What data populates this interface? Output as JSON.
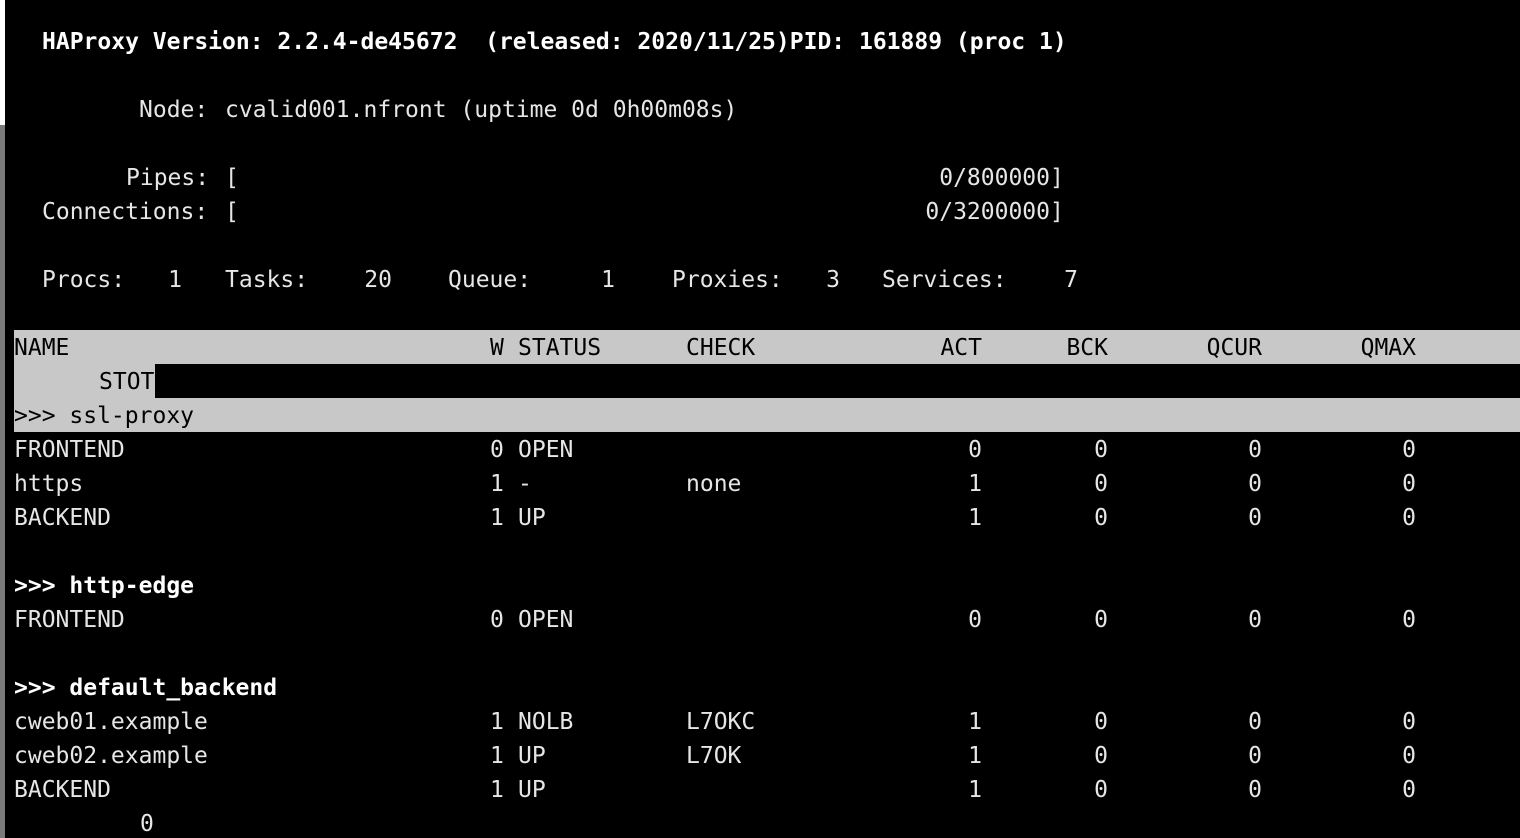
{
  "header": {
    "version_line": "HAProxy Version: 2.2.4-de45672  (released: 2020/11/25)PID: 161889 (proc 1)",
    "node_label": "Node:",
    "node_value": "cvalid001.nfront (uptime 0d 0h00m08s)",
    "pipes_label": "Pipes:",
    "pipes_value": "0/800000",
    "connections_label": "Connections:",
    "connections_value": "0/3200000",
    "bracket_open": "[",
    "bracket_close": "]"
  },
  "stats": {
    "procs_label": "Procs:",
    "procs_value": "1",
    "tasks_label": "Tasks:",
    "tasks_value": "20",
    "queue_label": "Queue:",
    "queue_value": "1",
    "proxies_label": "Proxies:",
    "proxies_value": "3",
    "services_label": "Services:",
    "services_value": "7"
  },
  "columns": {
    "name": "NAME",
    "w": "W",
    "status": "STATUS",
    "check": "CHECK",
    "act": "ACT",
    "bck": "BCK",
    "qcur": "QCUR",
    "qmax": "QMAX",
    "stot": "STOT"
  },
  "groups": [
    {
      "title": ">>> ssl-proxy",
      "rows": [
        {
          "name": "FRONTEND",
          "w": "0",
          "status": "OPEN",
          "check": "",
          "act": "0",
          "bck": "0",
          "qcur": "0",
          "qmax": "0"
        },
        {
          "name": "https",
          "w": "1",
          "status": "-",
          "check": "none",
          "act": "1",
          "bck": "0",
          "qcur": "0",
          "qmax": "0"
        },
        {
          "name": "BACKEND",
          "w": "1",
          "status": "UP",
          "check": "",
          "act": "1",
          "bck": "0",
          "qcur": "0",
          "qmax": "0"
        }
      ]
    },
    {
      "title": ">>> http-edge",
      "rows": [
        {
          "name": "FRONTEND",
          "w": "0",
          "status": "OPEN",
          "check": "",
          "act": "0",
          "bck": "0",
          "qcur": "0",
          "qmax": "0"
        }
      ]
    },
    {
      "title": ">>> default_backend",
      "rows": [
        {
          "name": "cweb01.example",
          "w": "1",
          "status": "NOLB",
          "check": "L7OKC",
          "act": "1",
          "bck": "0",
          "qcur": "0",
          "qmax": "0"
        },
        {
          "name": "cweb02.example",
          "w": "1",
          "status": "UP",
          "check": "L7OK",
          "act": "1",
          "bck": "0",
          "qcur": "0",
          "qmax": "0"
        },
        {
          "name": "BACKEND",
          "w": "1",
          "status": "UP",
          "check": "",
          "act": "1",
          "bck": "0",
          "qcur": "0",
          "qmax": "0"
        }
      ]
    }
  ],
  "trailing_value": "0"
}
